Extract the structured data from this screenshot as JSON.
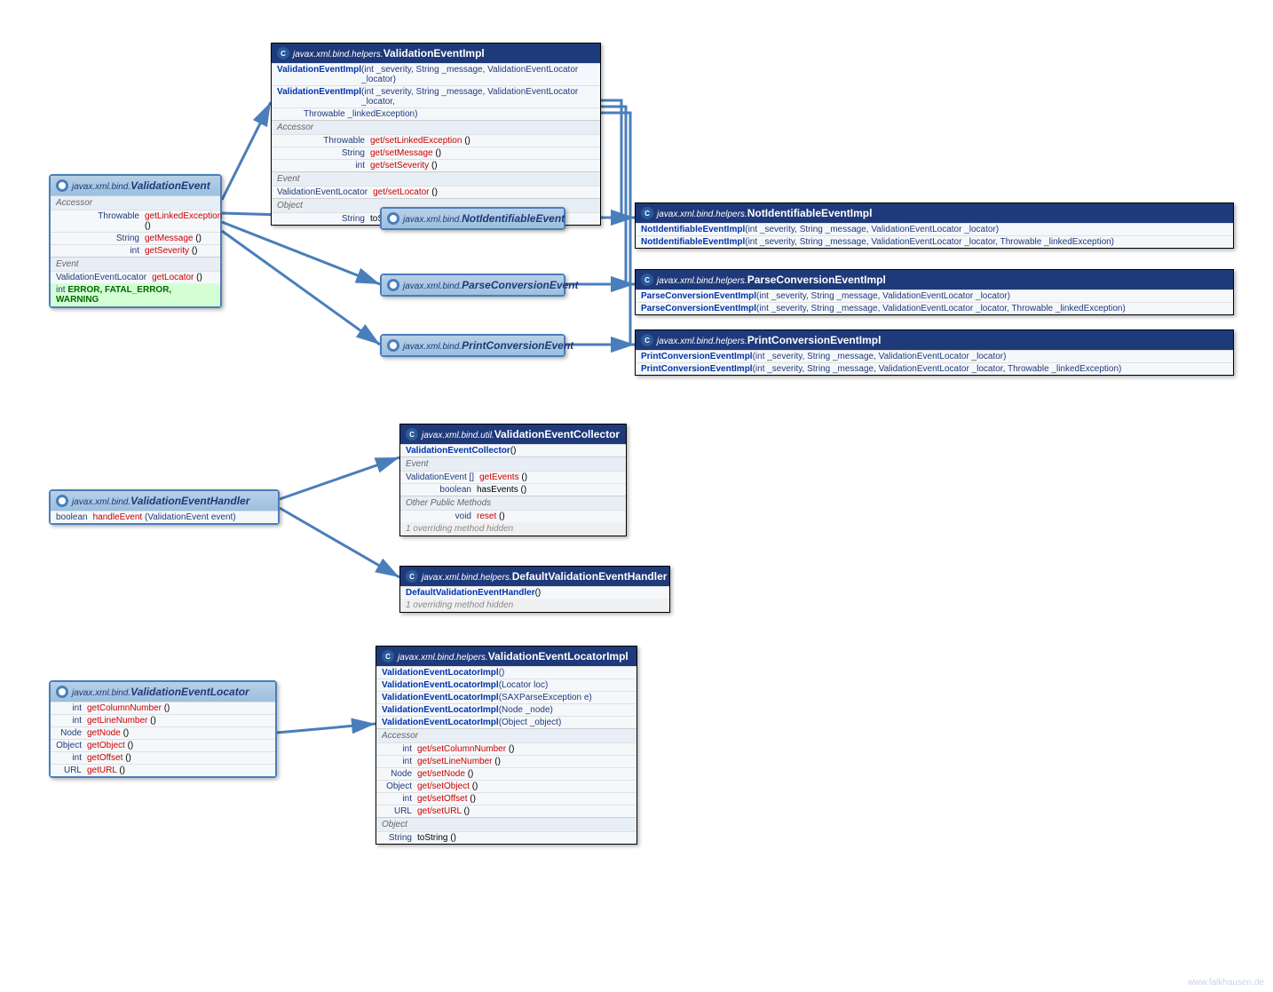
{
  "validationEvent": {
    "pkg": "javax.xml.bind.",
    "name": "ValidationEvent",
    "sections": [
      {
        "label": "Accessor",
        "rows": [
          {
            "ret": "Throwable",
            "name": "getLinkedException",
            "params": "()"
          },
          {
            "ret": "String",
            "name": "getMessage",
            "params": "()"
          },
          {
            "ret": "int",
            "name": "getSeverity",
            "params": "()"
          }
        ]
      },
      {
        "label": "Event",
        "rows": [
          {
            "ret": "ValidationEventLocator",
            "name": "getLocator",
            "params": "()"
          }
        ]
      }
    ],
    "consts": {
      "type": "int",
      "names": "ERROR, FATAL_ERROR, WARNING"
    }
  },
  "validationEventImpl": {
    "pkg": "javax.xml.bind.helpers.",
    "name": "ValidationEventImpl",
    "ctors": [
      {
        "name": "ValidationEventImpl",
        "params": "(int _severity, String _message, ValidationEventLocator _locator)"
      },
      {
        "name": "ValidationEventImpl",
        "params": "(int _severity, String _message, ValidationEventLocator _locator,",
        "cont": "Throwable _linkedException)"
      }
    ],
    "sections": [
      {
        "label": "Accessor",
        "rows": [
          {
            "ret": "Throwable",
            "name": "get/setLinkedException",
            "params": "()"
          },
          {
            "ret": "String",
            "name": "get/setMessage",
            "params": "()"
          },
          {
            "ret": "int",
            "name": "get/setSeverity",
            "params": "()"
          }
        ]
      },
      {
        "label": "Event",
        "rows": [
          {
            "ret": "ValidationEventLocator",
            "name": "get/setLocator",
            "params": "()"
          }
        ]
      },
      {
        "label": "Object",
        "rows": [
          {
            "ret": "String",
            "name": "toString",
            "params": "()",
            "black": true
          }
        ]
      }
    ]
  },
  "notIdentifiableEvent": {
    "pkg": "javax.xml.bind.",
    "name": "NotIdentifiableEvent"
  },
  "parseConversionEvent": {
    "pkg": "javax.xml.bind.",
    "name": "ParseConversionEvent"
  },
  "printConversionEvent": {
    "pkg": "javax.xml.bind.",
    "name": "PrintConversionEvent"
  },
  "notIdentifiableEventImpl": {
    "pkg": "javax.xml.bind.helpers.",
    "name": "NotIdentifiableEventImpl",
    "ctors": [
      {
        "name": "NotIdentifiableEventImpl",
        "params": "(int _severity, String _message, ValidationEventLocator _locator)"
      },
      {
        "name": "NotIdentifiableEventImpl",
        "params": "(int _severity, String _message, ValidationEventLocator _locator, Throwable _linkedException)"
      }
    ]
  },
  "parseConversionEventImpl": {
    "pkg": "javax.xml.bind.helpers.",
    "name": "ParseConversionEventImpl",
    "ctors": [
      {
        "name": "ParseConversionEventImpl",
        "params": "(int _severity, String _message, ValidationEventLocator _locator)"
      },
      {
        "name": "ParseConversionEventImpl",
        "params": "(int _severity, String _message, ValidationEventLocator _locator, Throwable _linkedException)"
      }
    ]
  },
  "printConversionEventImpl": {
    "pkg": "javax.xml.bind.helpers.",
    "name": "PrintConversionEventImpl",
    "ctors": [
      {
        "name": "PrintConversionEventImpl",
        "params": "(int _severity, String _message, ValidationEventLocator _locator)"
      },
      {
        "name": "PrintConversionEventImpl",
        "params": "(int _severity, String _message, ValidationEventLocator _locator, Throwable _linkedException)"
      }
    ]
  },
  "validationEventHandler": {
    "pkg": "javax.xml.bind.",
    "name": "ValidationEventHandler",
    "rows": [
      {
        "ret": "boolean",
        "name": "handleEvent",
        "params": "(ValidationEvent event)"
      }
    ]
  },
  "validationEventCollector": {
    "pkg": "javax.xml.bind.util.",
    "name": "ValidationEventCollector",
    "ctors": [
      {
        "name": "ValidationEventCollector",
        "params": "()"
      }
    ],
    "sections": [
      {
        "label": "Event",
        "rows": [
          {
            "ret": "ValidationEvent []",
            "name": "getEvents",
            "params": "()"
          },
          {
            "ret": "boolean",
            "name": "hasEvents",
            "params": "()",
            "black": true
          }
        ]
      },
      {
        "label": "Other Public Methods",
        "rows": [
          {
            "ret": "void",
            "name": "reset",
            "params": "()"
          }
        ]
      }
    ],
    "hidden": "1 overriding method hidden"
  },
  "defaultValidationEventHandler": {
    "pkg": "javax.xml.bind.helpers.",
    "name": "DefaultValidationEventHandler",
    "ctors": [
      {
        "name": "DefaultValidationEventHandler",
        "params": "()"
      }
    ],
    "hidden": "1 overriding method hidden"
  },
  "validationEventLocator": {
    "pkg": "javax.xml.bind.",
    "name": "ValidationEventLocator",
    "rows": [
      {
        "ret": "int",
        "name": "getColumnNumber",
        "params": "()"
      },
      {
        "ret": "int",
        "name": "getLineNumber",
        "params": "()"
      },
      {
        "ret": "Node",
        "name": "getNode",
        "params": "()"
      },
      {
        "ret": "Object",
        "name": "getObject",
        "params": "()"
      },
      {
        "ret": "int",
        "name": "getOffset",
        "params": "()"
      },
      {
        "ret": "URL",
        "name": "getURL",
        "params": "()"
      }
    ]
  },
  "validationEventLocatorImpl": {
    "pkg": "javax.xml.bind.helpers.",
    "name": "ValidationEventLocatorImpl",
    "ctors": [
      {
        "name": "ValidationEventLocatorImpl",
        "params": "()"
      },
      {
        "name": "ValidationEventLocatorImpl",
        "params": "(Locator loc)"
      },
      {
        "name": "ValidationEventLocatorImpl",
        "params": "(SAXParseException e)"
      },
      {
        "name": "ValidationEventLocatorImpl",
        "params": "(Node _node)"
      },
      {
        "name": "ValidationEventLocatorImpl",
        "params": "(Object _object)"
      }
    ],
    "sections": [
      {
        "label": "Accessor",
        "rows": [
          {
            "ret": "int",
            "name": "get/setColumnNumber",
            "params": "()"
          },
          {
            "ret": "int",
            "name": "get/setLineNumber",
            "params": "()"
          },
          {
            "ret": "Node",
            "name": "get/setNode",
            "params": "()"
          },
          {
            "ret": "Object",
            "name": "get/setObject",
            "params": "()"
          },
          {
            "ret": "int",
            "name": "get/setOffset",
            "params": "()"
          },
          {
            "ret": "URL",
            "name": "get/setURL",
            "params": "()"
          }
        ]
      },
      {
        "label": "Object",
        "rows": [
          {
            "ret": "String",
            "name": "toString",
            "params": "()",
            "black": true
          }
        ]
      }
    ]
  },
  "watermark": "www.falkhausen.de"
}
